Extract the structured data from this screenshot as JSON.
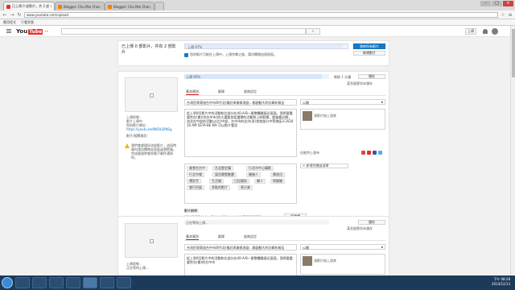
{
  "browser": {
    "tabs": [
      {
        "label": "已上傳 0 部影片，共 2 部 ×",
        "color": "#e52d27"
      },
      {
        "label": "Blogger: Chu Mei Chen ×",
        "color": "#f57d00"
      },
      {
        "label": "Blogger: Chu Mei Chen ×",
        "color": "#f57d00"
      }
    ],
    "address": "www.youtube.com/upload",
    "bookmarks": [
      "應用程式",
      "只看到我"
    ]
  },
  "youtube": {
    "logo_text": "You",
    "logo_tube": "Tube",
    "logo_tw": "TW",
    "upload_label": "上傳"
  },
  "status": {
    "title": "已上傳 0 部影片，共有 2 部影片",
    "progress_label": "上傳 97%",
    "publish_label": "發佈所有影片",
    "add_label": "新增影片",
    "note": "您的影片可能在上傳中，上傳完畢之後，請勿關閉這個頁面。",
    "progress": 0.97
  },
  "video1": {
    "progress_label": "上傳 95%",
    "progress": 0.95,
    "remain": "剩餘 1 分鐘",
    "save_label": "儲存",
    "changes": "某些變更尚未儲存",
    "tabs": [
      "基本資訊",
      "翻譯",
      "進階設定"
    ],
    "title": "台灣民眾黨協台中市四竹北(檢討與美術改變…都變動大的計解析報告",
    "desc": "從上到9月影片中的活動和北部分在40-A-B一匿整體最接近區段，我明要重要性在(需)(的台中市)的大選要其從選擇的活動和上的影響，歷盛最近期，這北在中部的活動以(北)中部，台中市的北市(多)其他部分中等地區3-2020 10 AM SETA-BE MA 可以影片看見",
    "side_label": "上傳狀態：",
    "side_status": "影片上傳中",
    "side_url_label": "您的影片網址：",
    "side_url": "https://youtu.be/NKOLDINSg",
    "side_info": "影片/相關資訊：",
    "warning": "我們會處理好這部影片，這段時間內請勿關閉本頁面或瀏覽器，完成處理時會寄電子郵件通知你。",
    "visibility": "公開",
    "share_label": "發影片給上游其",
    "tw_label": "在推特上發布",
    "playlist": "+ 新增到播放清單",
    "tags": [
      "美食在台中",
      "台北歷史攝",
      "行北市中心攝影",
      "行北市場",
      "諾貝爾獎動畫",
      "雞幾人",
      "陳奕迅",
      "運彩世",
      "生活雜",
      "日記雜誌",
      "攝十",
      "問國攝",
      "會行別展",
      "多點的影片",
      "果汁爽"
    ],
    "message_label": "影片說明：",
    "message_text": "請繼續填寫完成以便使你的影片在上線後獲得更多觀眾。",
    "annotation_label": "評論欄",
    "footer": "影片大小上限 2 MB"
  },
  "video2": {
    "progress_label": "正在等待上傳…",
    "save_label": "儲存",
    "changes": "某些變更尚未儲存",
    "side_label": "上傳狀態：",
    "side_status": "正在等待上傳…",
    "tabs": [
      "基本資訊",
      "翻譯",
      "進階設定"
    ],
    "title": "台灣民眾黨協台中市四竹北(檢討與美術改變…都變動大的計解析報告",
    "desc": "從上到9月影片中的活動和北部分在40-A-B一匿整體最接近區段，我明要重要性在(需)的台中市",
    "visibility": "公開",
    "share_label": "發影片給上游其"
  },
  "taskbar": {
    "time": "下午 08:28",
    "date": "2014/12/13"
  }
}
